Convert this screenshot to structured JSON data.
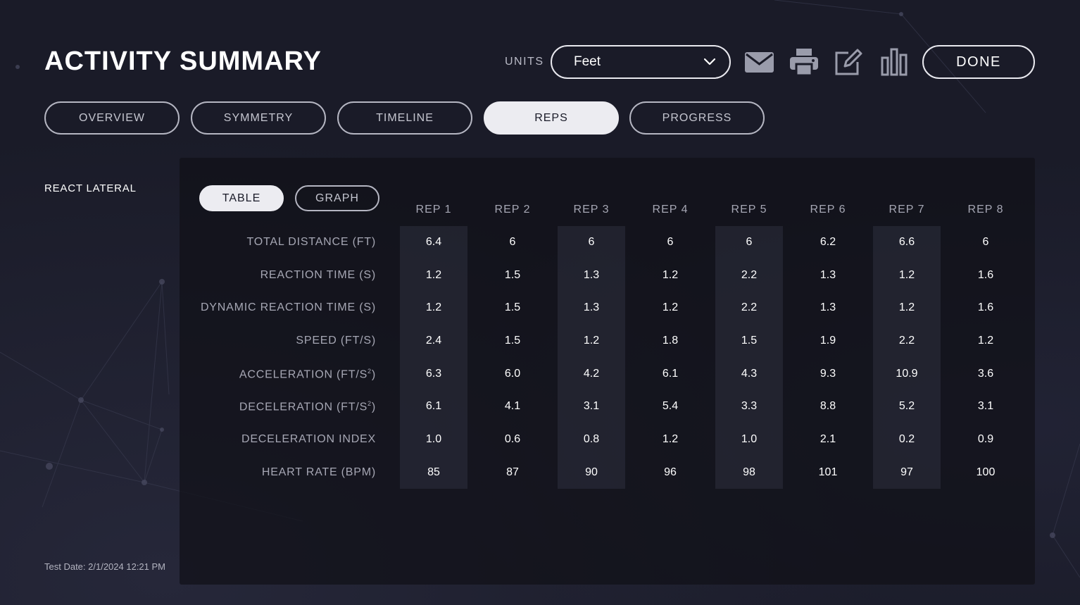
{
  "header": {
    "title": "ACTIVITY SUMMARY",
    "units_label": "UNITS",
    "units_value": "Feet",
    "done_label": "DONE",
    "icons": [
      "envelope-icon",
      "printer-icon",
      "edit-icon",
      "bar-chart-icon"
    ]
  },
  "tabs": [
    {
      "label": "OVERVIEW",
      "active": false
    },
    {
      "label": "SYMMETRY",
      "active": false
    },
    {
      "label": "TIMELINE",
      "active": false
    },
    {
      "label": "REPS",
      "active": true
    },
    {
      "label": "PROGRESS",
      "active": false
    }
  ],
  "activity": {
    "name": "REACT LATERAL"
  },
  "test_date": "Test Date: 2/1/2024 12:21 PM",
  "view_toggle": {
    "table": "TABLE",
    "graph": "GRAPH",
    "selected": "TABLE"
  },
  "table": {
    "columns": [
      "REP 1",
      "REP 2",
      "REP 3",
      "REP 4",
      "REP 5",
      "REP 6",
      "REP 7",
      "REP 8"
    ],
    "rows": [
      {
        "label": "TOTAL DISTANCE (FT)",
        "values": [
          "6.4",
          "6",
          "6",
          "6",
          "6",
          "6.2",
          "6.6",
          "6"
        ]
      },
      {
        "label": "REACTION TIME (S)",
        "values": [
          "1.2",
          "1.5",
          "1.3",
          "1.2",
          "2.2",
          "1.3",
          "1.2",
          "1.6"
        ]
      },
      {
        "label": "DYNAMIC REACTION TIME (S)",
        "values": [
          "1.2",
          "1.5",
          "1.3",
          "1.2",
          "2.2",
          "1.3",
          "1.2",
          "1.6"
        ]
      },
      {
        "label": "SPEED (FT/S)",
        "values": [
          "2.4",
          "1.5",
          "1.2",
          "1.8",
          "1.5",
          "1.9",
          "2.2",
          "1.2"
        ]
      },
      {
        "label": "ACCELERATION (FT/S",
        "sup": "2",
        "suffix": ")",
        "values": [
          "6.3",
          "6.0",
          "4.2",
          "6.1",
          "4.3",
          "9.3",
          "10.9",
          "3.6"
        ]
      },
      {
        "label": "DECELERATION (FT/S",
        "sup": "2",
        "suffix": ")",
        "values": [
          "6.1",
          "4.1",
          "3.1",
          "5.4",
          "3.3",
          "8.8",
          "5.2",
          "3.1"
        ]
      },
      {
        "label": "DECELERATION INDEX",
        "values": [
          "1.0",
          "0.6",
          "0.8",
          "1.2",
          "1.0",
          "2.1",
          "0.2",
          "0.9"
        ]
      },
      {
        "label": "HEART RATE (BPM)",
        "values": [
          "85",
          "87",
          "90",
          "96",
          "98",
          "101",
          "97",
          "100"
        ]
      }
    ]
  },
  "colors": {
    "background": "#1a1b28",
    "panel": "#101018",
    "active_pill": "#ececf1",
    "muted_text": "#a6a7b4"
  }
}
